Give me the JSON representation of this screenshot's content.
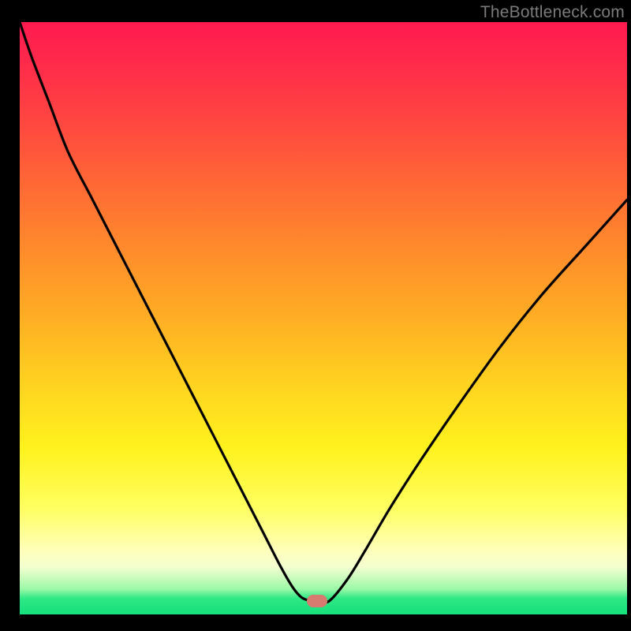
{
  "watermark": "TheBottleneck.com",
  "colors": {
    "frame_bg": "#000000",
    "watermark": "#7a7a7a",
    "curve_stroke": "#000000",
    "dot_fill": "#d77a70"
  },
  "chart_data": {
    "type": "line",
    "title": "",
    "xlabel": "",
    "ylabel": "",
    "xlim": [
      0,
      100
    ],
    "ylim": [
      0,
      100
    ],
    "grid": false,
    "legend": false,
    "x": [
      0,
      2,
      5,
      8,
      12,
      16,
      20,
      24,
      28,
      32,
      36,
      40,
      43,
      45,
      46.5,
      48,
      49.5,
      51,
      54,
      57,
      61,
      66,
      72,
      79,
      86,
      93,
      100
    ],
    "values": [
      100,
      94,
      86,
      78,
      70,
      62,
      54,
      46,
      38,
      30,
      22,
      14,
      8,
      4.5,
      2.8,
      2.3,
      2.3,
      2.3,
      6,
      11,
      18,
      26,
      35,
      45,
      54,
      62,
      70
    ],
    "minimum_marker": {
      "x": 49,
      "y": 2.3
    },
    "background_gradient_stops": [
      {
        "pos": 0.0,
        "color": "#ff1a4f"
      },
      {
        "pos": 0.49,
        "color": "#ffab24"
      },
      {
        "pos": 0.82,
        "color": "#ffff60"
      },
      {
        "pos": 0.973,
        "color": "#2ee884"
      },
      {
        "pos": 1.0,
        "color": "#16e07b"
      }
    ]
  }
}
